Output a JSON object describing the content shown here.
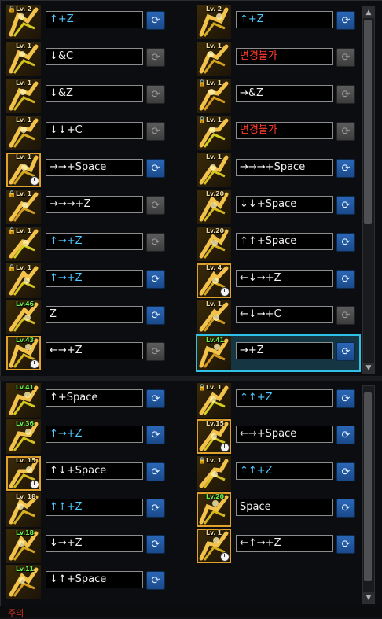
{
  "colors": {
    "command_white": "#f0f0f0",
    "command_cyan": "#4fc9ff",
    "command_red": "#ff3b2f",
    "reset_blue": "#2b67b7",
    "selection": "#2fc2e6"
  },
  "icons": {
    "reset": "refresh-icon",
    "lock": "lock-icon",
    "cooldown": "clock-icon"
  },
  "top_left": [
    {
      "lv": "Lv. 2",
      "cmd": "↑+Z",
      "color": "cyan",
      "locked": true,
      "reset": "enabled"
    },
    {
      "lv": "Lv. 1",
      "cmd": "↓&C",
      "color": "white",
      "locked": false,
      "reset": "disabled"
    },
    {
      "lv": "Lv. 1",
      "cmd": "↓&Z",
      "color": "white",
      "locked": false,
      "reset": "disabled"
    },
    {
      "lv": "Lv. 1",
      "cmd": "↓↓+C",
      "color": "white",
      "locked": false,
      "reset": "disabled"
    },
    {
      "lv": "Lv. 1",
      "cmd": "→→+Space",
      "color": "white",
      "locked": false,
      "reset": "enabled",
      "clock": true,
      "selected": true
    },
    {
      "lv": "Lv. 1",
      "cmd": "→→→+Z",
      "color": "white",
      "locked": true,
      "reset": "disabled"
    },
    {
      "lv": "Lv. 1",
      "cmd": "↑→+Z",
      "color": "cyan",
      "locked": true,
      "reset": "disabled"
    },
    {
      "lv": "Lv. 1",
      "cmd": "↑→+Z",
      "color": "cyan",
      "locked": true,
      "reset": "enabled"
    },
    {
      "lv": "Lv.46",
      "cmd": "Z",
      "color": "white",
      "locked": false,
      "reset": "enabled",
      "green": true
    },
    {
      "lv": "Lv.43",
      "cmd": "←→+Z",
      "color": "white",
      "locked": false,
      "reset": "disabled",
      "green": true,
      "clock": true,
      "selected": true
    }
  ],
  "top_right": [
    {
      "lv": "Lv. 2",
      "cmd": "↑+Z",
      "color": "cyan",
      "locked": false,
      "reset": "enabled"
    },
    {
      "lv": "Lv. 1",
      "cmd": "변경불가",
      "color": "red",
      "locked": false,
      "reset": "disabled"
    },
    {
      "lv": "Lv. 1",
      "cmd": "→&Z",
      "color": "white",
      "locked": true,
      "reset": "disabled"
    },
    {
      "lv": "Lv. 1",
      "cmd": "변경불가",
      "color": "red",
      "locked": true,
      "reset": "disabled"
    },
    {
      "lv": "Lv. 1",
      "cmd": "→→→+Space",
      "color": "white",
      "locked": false,
      "reset": "enabled"
    },
    {
      "lv": "Lv.20",
      "cmd": "↓↓+Space",
      "color": "white",
      "locked": false,
      "reset": "enabled"
    },
    {
      "lv": "Lv.20",
      "cmd": "↑↑+Space",
      "color": "white",
      "locked": false,
      "reset": "enabled"
    },
    {
      "lv": "Lv. 4",
      "cmd": "←↓→+Z",
      "color": "white",
      "locked": false,
      "reset": "enabled",
      "clock": true,
      "selected": true
    },
    {
      "lv": "Lv. 1",
      "cmd": "←↓→+C",
      "color": "white",
      "locked": false,
      "reset": "disabled"
    },
    {
      "lv": "Lv.41",
      "cmd": "→+Z",
      "color": "white",
      "locked": false,
      "reset": "enabled",
      "green": true
    }
  ],
  "bottom_left": [
    {
      "lv": "Lv.41",
      "cmd": "↑+Space",
      "color": "white",
      "locked": false,
      "reset": "enabled",
      "green": true
    },
    {
      "lv": "Lv.36",
      "cmd": "↑→+Z",
      "color": "cyan",
      "locked": false,
      "reset": "enabled",
      "green": true
    },
    {
      "lv": "Lv. 15",
      "cmd": "↑↓+Space",
      "color": "white",
      "locked": false,
      "reset": "enabled",
      "clock": true,
      "selected": true
    },
    {
      "lv": "Lv. 18",
      "cmd": "↑↑+Z",
      "color": "cyan",
      "locked": false,
      "reset": "enabled"
    },
    {
      "lv": "Lv.18",
      "cmd": "↓→+Z",
      "color": "white",
      "locked": false,
      "reset": "enabled",
      "green": true
    },
    {
      "lv": "Lv.11",
      "cmd": "↓↑+Space",
      "color": "white",
      "locked": false,
      "reset": "enabled",
      "green": true
    }
  ],
  "bottom_right": [
    {
      "lv": "Lv. 1",
      "cmd": "↑↑+Z",
      "color": "cyan",
      "locked": true,
      "reset": "enabled"
    },
    {
      "lv": "Lv.15",
      "cmd": "←→+Space",
      "color": "white",
      "locked": false,
      "reset": "enabled",
      "clock": true,
      "selected": true
    },
    {
      "lv": "Lv. 1",
      "cmd": "↑↑+Z",
      "color": "cyan",
      "locked": true,
      "reset": "enabled"
    },
    {
      "lv": "Lv.20",
      "cmd": "Space",
      "color": "white",
      "locked": false,
      "reset": "enabled",
      "green": true,
      "selected": true
    },
    {
      "lv": "Lv. 1",
      "cmd": "←↑→+Z",
      "color": "white",
      "locked": false,
      "reset": "enabled",
      "clock": true,
      "selected": true
    }
  ],
  "footer": {
    "label": "주의"
  }
}
